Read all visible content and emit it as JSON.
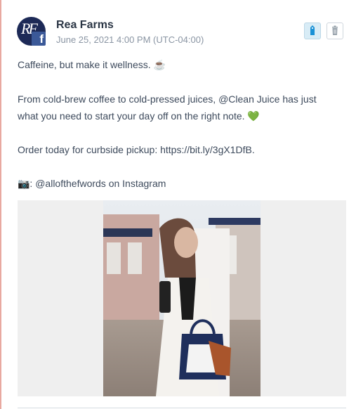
{
  "post": {
    "author": "Rea Farms",
    "timestamp": "June 25, 2021 4:00 PM (UTC-04:00)",
    "avatar_monogram": "RF",
    "network_badge": "f",
    "lines": [
      "Caffeine, but make it wellness. ☕",
      "From cold-brew coffee to cold-pressed juices, @Clean Juice has just",
      "what you need to start your day off on the right note. 💚",
      "Order today for curbside pickup: https://bit.ly/3gX1DfB.",
      "📷: @allofthefwords on Instagram"
    ]
  },
  "icons": {
    "tag": "tag-icon",
    "trash": "trash-icon",
    "network": "facebook-icon"
  },
  "colors": {
    "accent_rule": "#e8a9a0",
    "facebook": "#3b5998",
    "avatar_bg": "#1d2a57",
    "tag_active": "#1a91d6"
  }
}
